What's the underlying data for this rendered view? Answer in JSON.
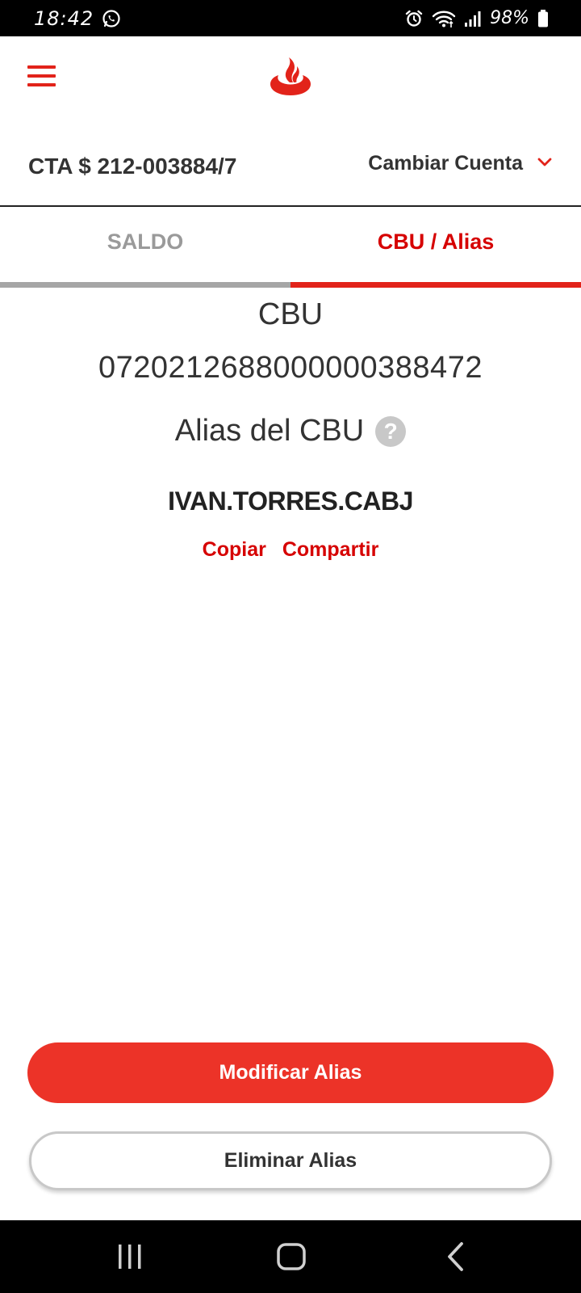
{
  "status_bar": {
    "time": "18:42",
    "battery": "98%",
    "icons": [
      "whatsapp-icon",
      "alarm-icon",
      "wifi-icon",
      "signal-icon",
      "battery-icon"
    ]
  },
  "header": {
    "menu_icon": "menu-icon",
    "logo": "santander-flame-logo",
    "brand_color": "#e2231a"
  },
  "account": {
    "number": "CTA $ 212-003884/7",
    "change_label": "Cambiar Cuenta"
  },
  "tabs": [
    {
      "label": "SALDO",
      "active": false
    },
    {
      "label": "CBU / Alias",
      "active": true
    }
  ],
  "cbu": {
    "title": "CBU",
    "number": "0720212688000000388472"
  },
  "alias": {
    "title": "Alias del CBU",
    "help": "?",
    "value": "IVAN.TORRES.CABJ",
    "copy_label": "Copiar",
    "share_label": "Compartir"
  },
  "actions": {
    "modify_label": "Modificar Alias",
    "delete_label": "Eliminar Alias"
  },
  "nav_bar": {
    "icons": [
      "recent-apps-icon",
      "home-icon",
      "back-icon"
    ]
  }
}
